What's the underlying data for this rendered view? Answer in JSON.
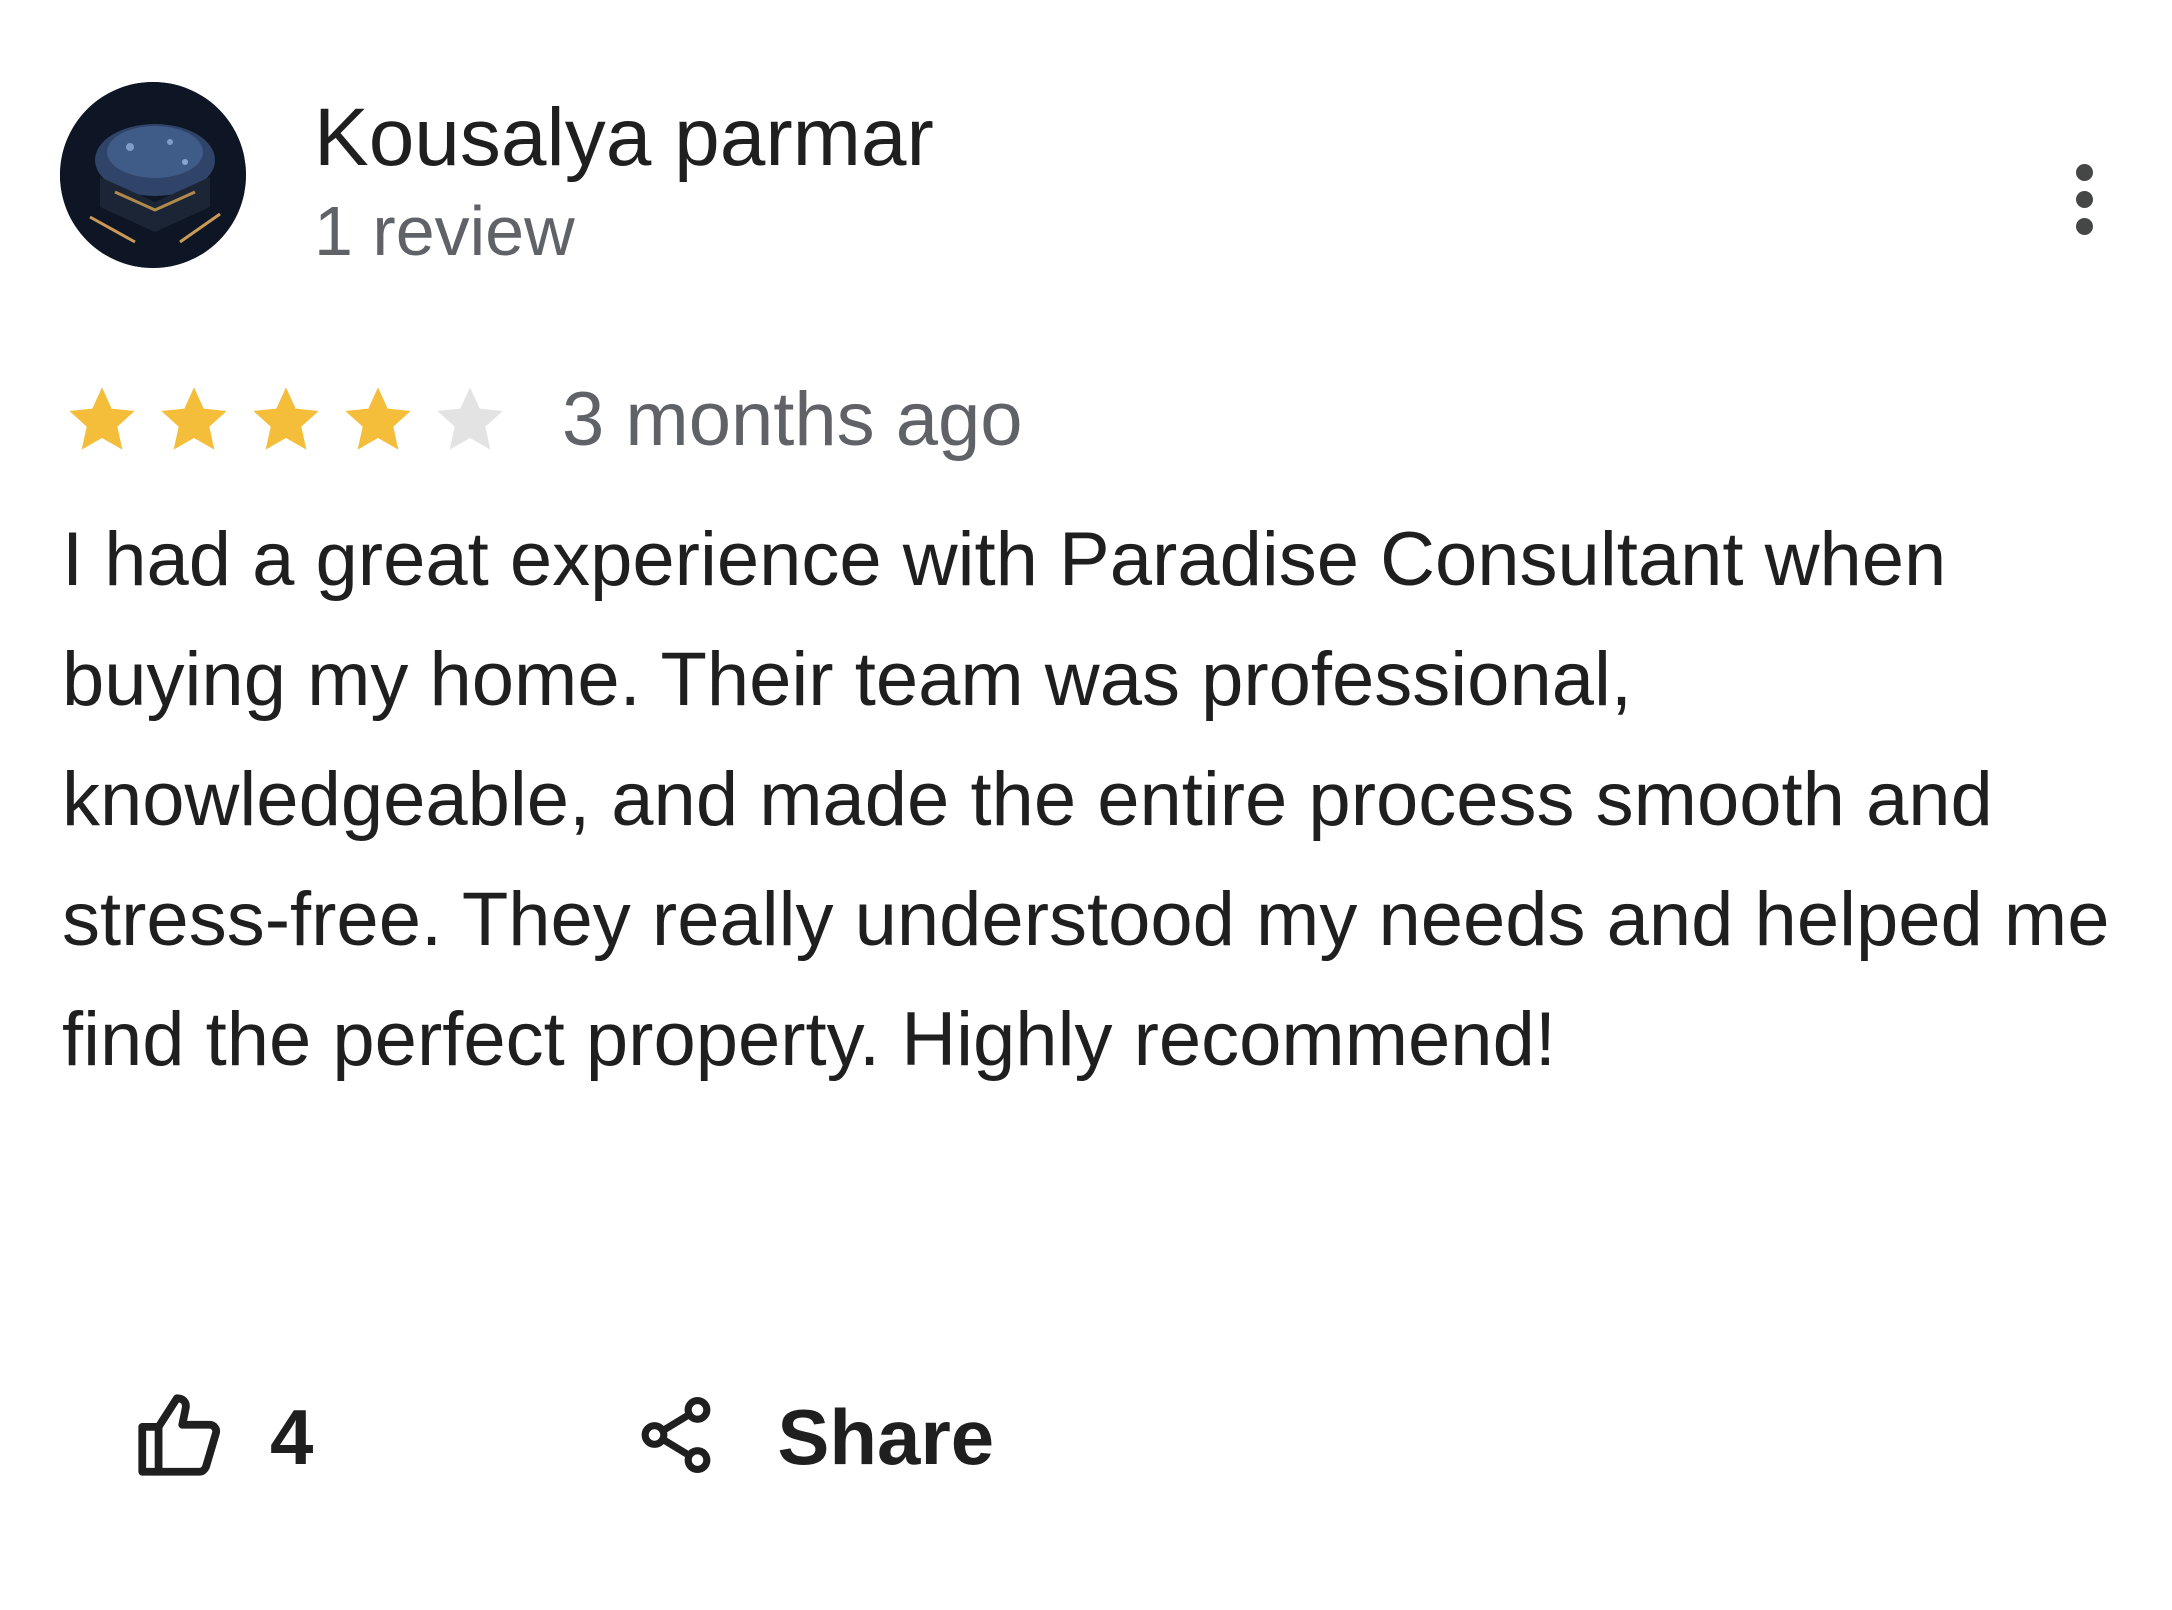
{
  "review": {
    "reviewer_name": "Kousalya parmar",
    "review_count": "1 review",
    "rating": 4,
    "rating_max": 5,
    "time_ago": "3 months ago",
    "text": "I had a great experience with Paradise Consultant when buying my home. Their team was professional, knowledgeable, and made the entire process smooth and stress-free. They really understood my needs and helped me find the perfect property. Highly recommend!"
  },
  "actions": {
    "like_count": "4",
    "share_label": "Share"
  },
  "icons": {
    "avatar": "avatar-image",
    "more": "more-vert-icon",
    "star": "star-icon",
    "like": "thumb-up-icon",
    "share": "share-icon"
  },
  "colors": {
    "star_filled": "#F4BE3A",
    "star_empty": "#E3E3E3",
    "text_primary": "#1F1F1F",
    "text_secondary": "#5F6368"
  }
}
